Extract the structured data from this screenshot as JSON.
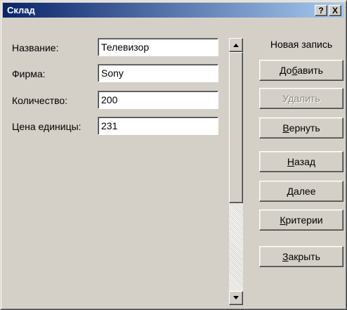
{
  "window": {
    "title": "Склад",
    "help_button": "?",
    "close_button": "X"
  },
  "form": {
    "fields": [
      {
        "label": "Название:",
        "value": "Телевизор"
      },
      {
        "label": "Фирма:",
        "value": "Sony"
      },
      {
        "label": "Количество:",
        "value": "200"
      },
      {
        "label": "Цена единицы:",
        "value": "231"
      }
    ]
  },
  "record_status": "Новая запись",
  "buttons": {
    "add": {
      "accel": "",
      "label_accel": "До",
      "accel_char": "б",
      "rest": "авить",
      "enabled": true
    },
    "delete": {
      "label": "Удалить",
      "enabled": false
    },
    "restore": {
      "accel_char": "В",
      "rest": "ернуть",
      "enabled": true
    },
    "back": {
      "accel_char": "Н",
      "rest": "азад",
      "enabled": true
    },
    "next": {
      "accel_char": "Д",
      "rest": "алее",
      "enabled": true
    },
    "criteria": {
      "accel_char": "К",
      "rest": "ритерии",
      "enabled": true
    },
    "close": {
      "accel_char": "З",
      "rest": "акрыть",
      "enabled": true
    }
  },
  "icons": {
    "scroll_up": "triangle-up-icon",
    "scroll_down": "triangle-down-icon"
  }
}
